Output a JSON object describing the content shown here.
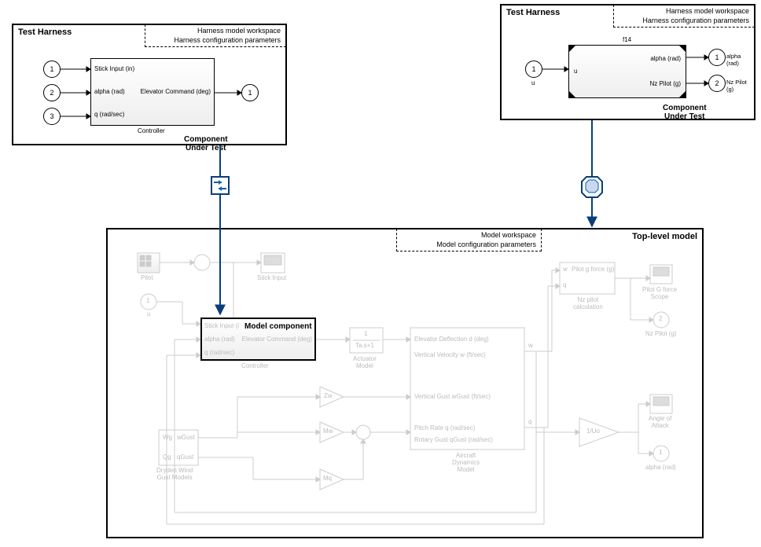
{
  "leftHarness": {
    "title": "Test Harness",
    "wsLine1": "Harness model workspace",
    "wsLine2": "Harness configuration parameters",
    "ports": {
      "p1": "1",
      "p2": "2",
      "p3": "3",
      "out1": "1"
    },
    "block": {
      "in1": "Stick Input (in)",
      "in2": "alpha (rad)",
      "in3": "q (rad/sec)",
      "out": "Elevator Command (deg)",
      "name": "Controller"
    },
    "cut": "Component\nUnder Test"
  },
  "rightHarness": {
    "title": "Test Harness",
    "wsLine1": "Harness model workspace",
    "wsLine2": "Harness configuration parameters",
    "ports": {
      "p1": "1",
      "out1": "1",
      "out2": "2",
      "uLabel": "u"
    },
    "block": {
      "top": "f14",
      "in": "u",
      "out1": "alpha (rad)",
      "out2": "Nz Pilot (g)",
      "o1lbl": "alpha (rad)",
      "o2lbl": "Nz Pilot (g)"
    },
    "cut": "Component\nUnder Test"
  },
  "topModel": {
    "title": "Top-level model",
    "wsLine1": "Model workspace",
    "wsLine2": "Model configuration parameters",
    "modelComponentLabel": "Model component",
    "labels": {
      "pilot": "Pilot",
      "stickInput": "Stick Input",
      "u": "u",
      "controllerIn1": "Stick Input (i",
      "controllerIn2": "alpha (rad)",
      "controllerIn3": "q (rad/sec)",
      "controllerOut": "Elevator Command (deg)",
      "controller": "Controller",
      "actuator1": "1",
      "actuator2": "Ta.s+1",
      "actuatorModel": "Actuator\nModel",
      "zw": "Zw",
      "mw": "Mw",
      "mq": "Mq",
      "wg": "Wg",
      "qg": "Qg",
      "wGust": "wGust",
      "qGust": "qGust",
      "dryden": "Dryden Wind\nGust Models",
      "dyn1": "Elevator Deflection d (deg)",
      "dyn2": "Vertical Velocity w (ft/sec)",
      "dyn3": "Vertical Gust wGust (ft/sec)",
      "dyn4": "Pitch Rate q (rad/sec)",
      "dyn5": "Rotary Gust qGust (rad/sec)",
      "dynModel": "Aircraft\nDynamics\nModel",
      "wSig": "w",
      "qSig": "q",
      "pilotG": "Pilot g force (g)",
      "nzCalc": "Nz pilot\ncalculation",
      "pilotGScope": "Pilot G force\nScope",
      "nzPilot": "Nz Pilot (g)",
      "oneUo": "1/Uo",
      "aoa": "Angle of\nAttack",
      "alphaRad": "alpha (rad)",
      "p1": "1",
      "p2": "2"
    }
  }
}
